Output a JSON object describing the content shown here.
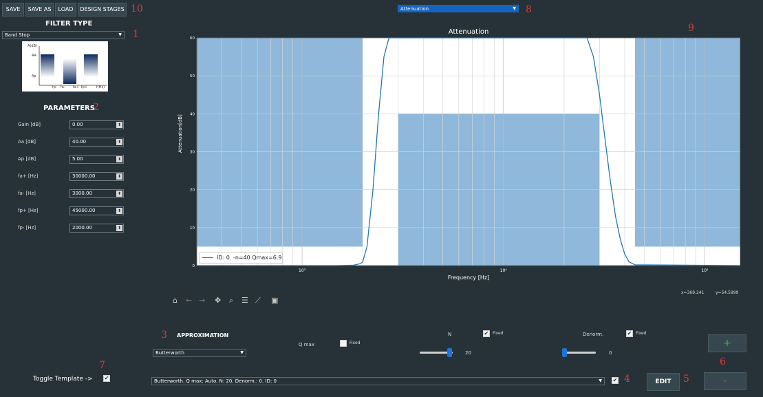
{
  "toolbar": {
    "save": "SAVE",
    "save_as": "SAVE AS",
    "load": "LOAD",
    "design_stages": "DESIGN STAGES"
  },
  "markers": {
    "m1": "1",
    "m2": "2",
    "m3": "3",
    "m4": "4",
    "m5": "5",
    "m6": "6",
    "m7": "7",
    "m8": "8",
    "m9": "9",
    "m10": "10"
  },
  "filter_type": {
    "heading": "FILTER TYPE",
    "selected": "Band Stop",
    "preview": {
      "y_label": "A(dB)",
      "aa": "AA",
      "ap": "Ap",
      "x_label": "f(Hz)",
      "f1": "fp-",
      "f2": "fa-",
      "f3": "fa+",
      "f4": "fp+"
    }
  },
  "parameters": {
    "heading": "PARAMETERS",
    "items": [
      {
        "label": "Gain [dB]",
        "value": "0.00"
      },
      {
        "label": "Aa [dB]",
        "value": "40.00"
      },
      {
        "label": "Ap [dB]",
        "value": "5.00"
      },
      {
        "label": "fa+ [Hz]",
        "value": "30000.00"
      },
      {
        "label": "fa- [Hz]",
        "value": "3000.00"
      },
      {
        "label": "fp+ [Hz]",
        "value": "45000.00"
      },
      {
        "label": "fp- [Hz]",
        "value": "2000.00"
      }
    ]
  },
  "plot_select": {
    "selected": "Attenuation"
  },
  "chart_data": {
    "type": "line",
    "title": "Attenuation",
    "xlabel": "Frequency [Hz]",
    "ylabel": "Attenuation[dB]",
    "x_scale": "log",
    "xlim": [
      300,
      150000
    ],
    "ylim": [
      0,
      60
    ],
    "x_ticks": [
      "10³",
      "10⁴",
      "10⁵"
    ],
    "y_ticks": [
      "0",
      "10",
      "20",
      "30",
      "40",
      "50",
      "60"
    ],
    "legend": "ID: 0. -n=40 Qmax=6.9",
    "legend_position": "bottom-left",
    "grid": true,
    "templates": [
      {
        "x_from": 300,
        "x_to": 2000,
        "y_from": 5,
        "y_to": 60
      },
      {
        "x_from": 3000,
        "x_to": 30000,
        "y_from": 0,
        "y_to": 40
      },
      {
        "x_from": 45000,
        "x_to": 150000,
        "y_from": 5,
        "y_to": 60
      }
    ],
    "series": [
      {
        "x": [
          300,
          1500,
          1800,
          1950,
          2000,
          2100,
          2250,
          2400,
          2550,
          2700,
          26000,
          28000,
          30000,
          32000,
          34000,
          36000,
          38000,
          40000,
          42000,
          45000,
          150000
        ],
        "y": [
          0,
          0,
          0.1,
          0.5,
          1,
          5,
          20,
          40,
          55,
          60,
          60,
          55,
          45,
          33,
          22,
          13,
          7,
          3,
          1,
          0.2,
          0
        ]
      }
    ]
  },
  "coords": {
    "x": "x=369.241",
    "y": "y=54.5999"
  },
  "approximation": {
    "heading": "APPROXIMATION",
    "selected": "Butterworth",
    "q_max_label": "Q max",
    "fixed_label": "Fixed",
    "n_label": "N",
    "n_value": "20",
    "denorm_label": "Denorm.",
    "denorm_value": "0"
  },
  "stages": {
    "selected": "Butterworth. Q max: Auto. N: 20. Denorm.: 0. ID: 0",
    "edit": "EDIT",
    "add": "+",
    "remove": "-"
  },
  "toggle_template": {
    "label": "Toggle Template ->"
  }
}
